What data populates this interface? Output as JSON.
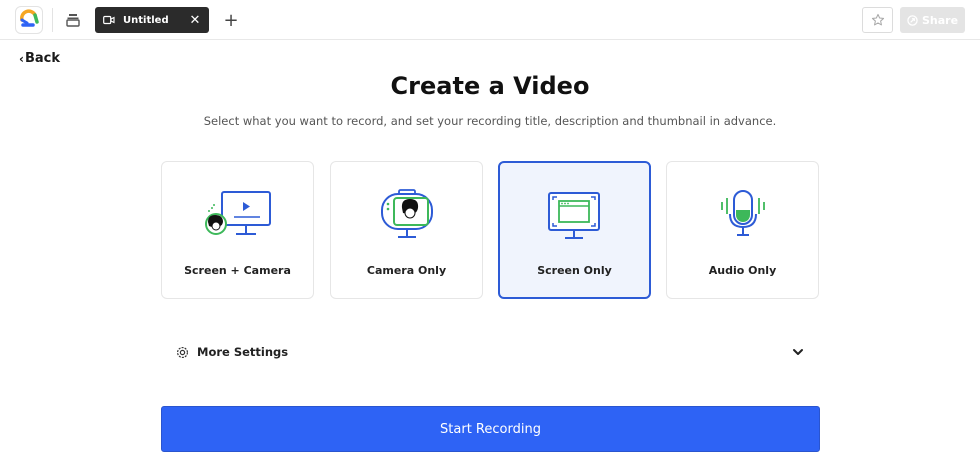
{
  "topbar": {
    "tab_title": "Untitled",
    "tab_close": "✕",
    "add_tab": "+",
    "share_label": "Share"
  },
  "nav": {
    "back_label": "Back",
    "back_chevron": "‹"
  },
  "header": {
    "title": "Create a Video",
    "subtitle": "Select what you want to record, and set your recording title, description and thumbnail in advance."
  },
  "options": [
    {
      "label": "Screen + Camera",
      "icon": "screen-camera-icon",
      "selected": false
    },
    {
      "label": "Camera Only",
      "icon": "camera-only-icon",
      "selected": false
    },
    {
      "label": "Screen Only",
      "icon": "screen-only-icon",
      "selected": true
    },
    {
      "label": "Audio Only",
      "icon": "microphone-icon",
      "selected": false
    }
  ],
  "more_settings": {
    "label": "More Settings",
    "icon": "gear-icon",
    "expand_icon": "chevron-down-icon"
  },
  "actions": {
    "start_label": "Start Recording"
  },
  "colors": {
    "accent_blue": "#2e63f5",
    "selected_border": "#2d5bd6",
    "selected_bg": "#f0f4fd",
    "illustration_blue": "#2d5bd6",
    "illustration_green": "#3db85a"
  }
}
